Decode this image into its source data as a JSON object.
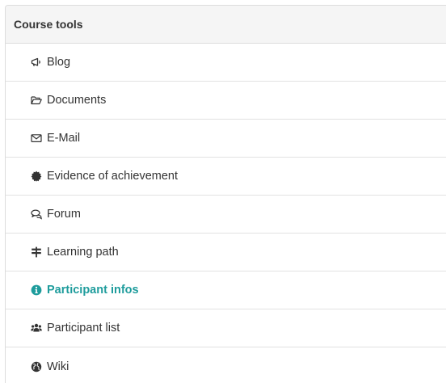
{
  "panel": {
    "title": "Course tools"
  },
  "tools": [
    {
      "label": "Blog",
      "icon": "megaphone-icon"
    },
    {
      "label": "Documents",
      "icon": "folder-open-icon"
    },
    {
      "label": "E-Mail",
      "icon": "envelope-icon"
    },
    {
      "label": "Evidence of achievement",
      "icon": "certificate-icon"
    },
    {
      "label": "Forum",
      "icon": "comments-icon"
    },
    {
      "label": "Learning path",
      "icon": "signpost-icon"
    },
    {
      "label": "Participant infos",
      "icon": "info-circle-icon",
      "active": true
    },
    {
      "label": "Participant list",
      "icon": "users-icon"
    },
    {
      "label": "Wiki",
      "icon": "globe-icon"
    }
  ],
  "colors": {
    "active": "#1e9c9c",
    "text": "#333333",
    "header_bg": "#f5f5f5",
    "border": "#dcdcdc"
  }
}
